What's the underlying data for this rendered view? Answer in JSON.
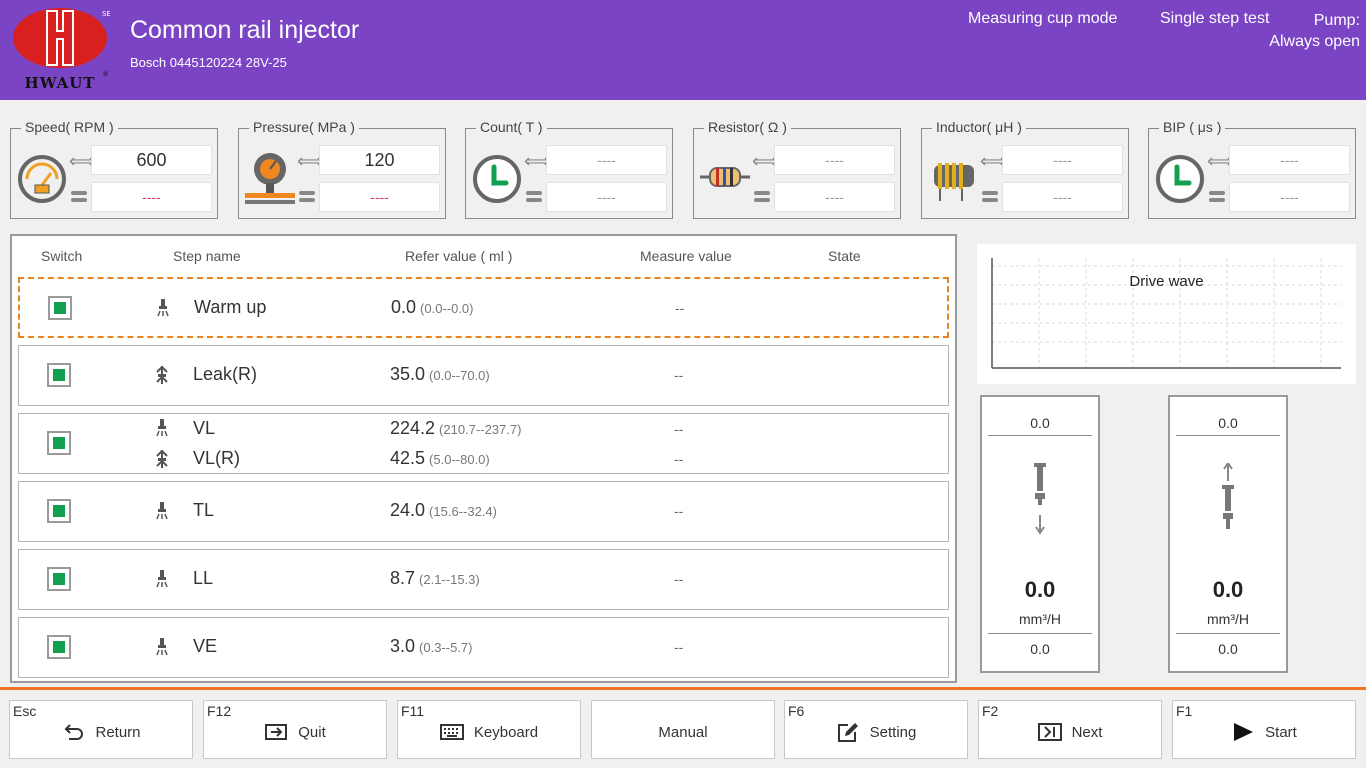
{
  "header": {
    "logo_text": "HWAUT",
    "title": "Common rail injector",
    "subtitle": "Bosch  0445120224  28V-25",
    "mode": "Measuring cup mode",
    "test_type": "Single step test",
    "pump_label": "Pump:",
    "pump_value": "Always open"
  },
  "gauges": [
    {
      "title": "Speed( RPM )",
      "icon": "speed-gauge-icon",
      "set": "600",
      "actual": "----"
    },
    {
      "title": "Pressure( MPa )",
      "icon": "pressure-gauge-icon",
      "set": "120",
      "actual": "----"
    },
    {
      "title": "Count( T )",
      "icon": "clock-icon",
      "set": "----",
      "actual": "----"
    },
    {
      "title": "Resistor( Ω )",
      "icon": "resistor-icon",
      "set": "----",
      "actual": "----"
    },
    {
      "title": "Inductor( μH )",
      "icon": "inductor-icon",
      "set": "----",
      "actual": "----"
    },
    {
      "title": "BIP ( μs )",
      "icon": "clock-icon",
      "set": "----",
      "actual": "----"
    }
  ],
  "table": {
    "headers": {
      "switch": "Switch",
      "step_name": "Step name",
      "refer": "Refer value ( ml )",
      "measure": "Measure value",
      "state": "State"
    },
    "rows": [
      {
        "name": "Warm up",
        "value": "0.0",
        "range": "(0.0--0.0)",
        "measure": "--",
        "icon": "injection-icon",
        "active": true
      },
      {
        "name": "Leak(R)",
        "value": "35.0",
        "range": "(0.0--70.0)",
        "measure": "--",
        "icon": "return-flow-icon"
      },
      {
        "name": "VL",
        "value": "224.2",
        "range": "(210.7--237.7)",
        "measure": "--",
        "icon": "injection-icon",
        "name2": "VL(R)",
        "value2": "42.5",
        "range2": "(5.0--80.0)",
        "measure2": "--"
      },
      {
        "name": "TL",
        "value": "24.0",
        "range": "(15.6--32.4)",
        "measure": "--",
        "icon": "injection-icon"
      },
      {
        "name": "LL",
        "value": "8.7",
        "range": "(2.1--15.3)",
        "measure": "--",
        "icon": "injection-icon"
      },
      {
        "name": "VE",
        "value": "3.0",
        "range": "(0.3--5.7)",
        "measure": "--",
        "icon": "injection-icon"
      }
    ]
  },
  "drive_wave": {
    "title": "Drive wave"
  },
  "flow_left": {
    "top": "0.0",
    "value": "0.0",
    "unit": "mm³/H",
    "bottom": "0.0",
    "icon": "injection-down-icon"
  },
  "flow_right": {
    "top": "0.0",
    "value": "0.0",
    "unit": "mm³/H",
    "bottom": "0.0",
    "icon": "return-up-icon"
  },
  "footer": [
    {
      "key": "Esc",
      "label": "Return",
      "icon": "return-icon"
    },
    {
      "key": "F12",
      "label": "Quit",
      "icon": "quit-icon"
    },
    {
      "key": "F11",
      "label": "Keyboard",
      "icon": "keyboard-icon"
    },
    {
      "key": "",
      "label": "Manual",
      "icon": ""
    },
    {
      "key": "F6",
      "label": "Setting",
      "icon": "setting-icon"
    },
    {
      "key": "F2",
      "label": "Next",
      "icon": "next-icon"
    },
    {
      "key": "F1",
      "label": "Start",
      "icon": "start-icon"
    }
  ],
  "colors": {
    "header_bg": "#7a44c4",
    "accent_orange": "#ef7322",
    "check_green": "#12a050",
    "logo_red": "#d8201f"
  }
}
